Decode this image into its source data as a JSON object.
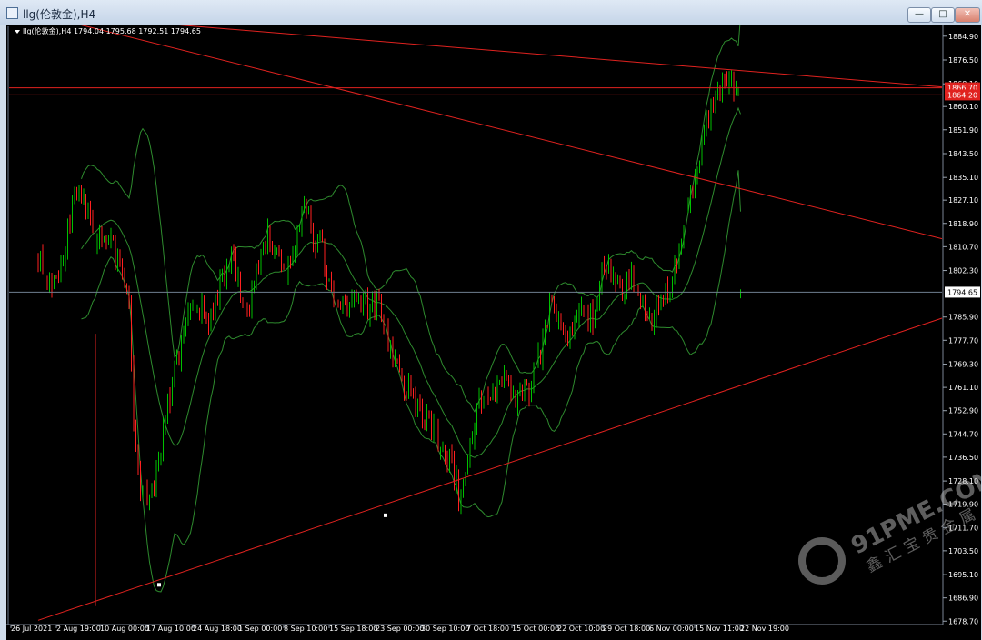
{
  "window": {
    "title": "llg(伦敦金),H4",
    "controls": {
      "minimize": "—",
      "maximize": "□",
      "close": "✕"
    }
  },
  "chart_data": {
    "type": "candlestick",
    "symbol_line": "llg(伦敦金),H4  1794.04 1795.68 1792.51 1794.65",
    "ohlc": {
      "open": 1794.04,
      "high": 1795.68,
      "low": 1792.51,
      "close": 1794.65
    },
    "ylim": [
      1677.5,
      1889
    ],
    "y_ticks": [
      1884.9,
      1876.5,
      1868.1,
      1860.1,
      1851.9,
      1843.5,
      1835.1,
      1827.1,
      1818.9,
      1810.7,
      1802.3,
      1785.9,
      1777.7,
      1769.3,
      1761.1,
      1752.9,
      1744.7,
      1736.5,
      1728.1,
      1719.9,
      1711.7,
      1703.5,
      1695.1,
      1686.9,
      1678.7
    ],
    "y_tick_labels": [
      "1884.90",
      "1876.50",
      "1868.10",
      "1860.10",
      "1851.90",
      "1843.50",
      "1835.10",
      "1827.10",
      "1818.90",
      "1810.70",
      "1802.30",
      "1785.90",
      "1777.70",
      "1769.30",
      "1761.10",
      "1752.90",
      "1744.70",
      "1736.50",
      "1728.10",
      "1719.90",
      "1711.70",
      "1703.50",
      "1695.10",
      "1686.90",
      "1678.70"
    ],
    "x_ticks": [
      "26 Jul 2021",
      "2 Aug 19:00",
      "10 Aug 00:00",
      "17 Aug 10:00",
      "24 Aug 18:00",
      "1 Sep 00:00",
      "8 Sep 10:00",
      "15 Sep 18:00",
      "23 Sep 00:00",
      "30 Sep 10:00",
      "7 Oct 18:00",
      "15 Oct 00:00",
      "22 Oct 10:00",
      "29 Oct 18:00",
      "6 Nov 00:00",
      "15 Nov 11:00",
      "22 Nov 19:00"
    ],
    "bars_count": 310,
    "path": [
      [
        0,
        1808
      ],
      [
        6,
        1797
      ],
      [
        10,
        1798
      ],
      [
        14,
        1816
      ],
      [
        18,
        1830
      ],
      [
        22,
        1822
      ],
      [
        26,
        1815
      ],
      [
        30,
        1815
      ],
      [
        34,
        1812
      ],
      [
        38,
        1802
      ],
      [
        41,
        1790
      ],
      [
        43,
        1750
      ],
      [
        46,
        1727
      ],
      [
        50,
        1720
      ],
      [
        54,
        1735
      ],
      [
        58,
        1755
      ],
      [
        62,
        1770
      ],
      [
        66,
        1782
      ],
      [
        70,
        1793
      ],
      [
        74,
        1788
      ],
      [
        78,
        1785
      ],
      [
        82,
        1800
      ],
      [
        86,
        1808
      ],
      [
        90,
        1796
      ],
      [
        94,
        1790
      ],
      [
        98,
        1805
      ],
      [
        102,
        1815
      ],
      [
        106,
        1808
      ],
      [
        110,
        1802
      ],
      [
        114,
        1812
      ],
      [
        118,
        1830
      ],
      [
        122,
        1814
      ],
      [
        126,
        1810
      ],
      [
        130,
        1795
      ],
      [
        134,
        1792
      ],
      [
        138,
        1790
      ],
      [
        142,
        1793
      ],
      [
        146,
        1788
      ],
      [
        150,
        1792
      ],
      [
        154,
        1780
      ],
      [
        158,
        1770
      ],
      [
        162,
        1760
      ],
      [
        166,
        1758
      ],
      [
        170,
        1752
      ],
      [
        174,
        1748
      ],
      [
        178,
        1740
      ],
      [
        182,
        1735
      ],
      [
        186,
        1723
      ],
      [
        190,
        1738
      ],
      [
        194,
        1752
      ],
      [
        198,
        1758
      ],
      [
        202,
        1760
      ],
      [
        206,
        1765
      ],
      [
        210,
        1758
      ],
      [
        214,
        1760
      ],
      [
        218,
        1762
      ],
      [
        222,
        1775
      ],
      [
        226,
        1790
      ],
      [
        230,
        1783
      ],
      [
        234,
        1776
      ],
      [
        238,
        1786
      ],
      [
        242,
        1788
      ],
      [
        246,
        1785
      ],
      [
        250,
        1806
      ],
      [
        254,
        1798
      ],
      [
        258,
        1795
      ],
      [
        262,
        1802
      ],
      [
        266,
        1792
      ],
      [
        270,
        1785
      ],
      [
        274,
        1792
      ],
      [
        278,
        1794
      ],
      [
        282,
        1805
      ],
      [
        286,
        1822
      ],
      [
        290,
        1834
      ],
      [
        294,
        1852
      ],
      [
        298,
        1862
      ],
      [
        302,
        1866
      ],
      [
        306,
        1869
      ],
      [
        310,
        1865
      ],
      [
        314,
        1862
      ],
      [
        318,
        1862
      ],
      [
        322,
        1848
      ],
      [
        326,
        1815
      ],
      [
        329,
        1792
      ],
      [
        331,
        1794.65
      ]
    ],
    "bollinger_bands": {
      "period": 20,
      "deviations": 2
    },
    "current_price": 1794.65,
    "current_price_label": "1794.65",
    "horizontal_lines": [
      1866.7,
      1864.2
    ],
    "horizontal_line_labels": [
      "1866.70",
      "1864.20"
    ],
    "trendlines": [
      {
        "from": [
          10,
          1893
        ],
        "to": [
          331,
          1867.0
        ]
      },
      {
        "from": [
          10,
          1893
        ],
        "to": [
          331,
          1813.5
        ]
      },
      {
        "from": [
          12,
          1679
        ],
        "to": [
          331,
          1785.5
        ]
      }
    ],
    "trendline_anchors": [
      [
        50,
        1691.5
      ],
      [
        144,
        1716
      ]
    ],
    "vertical_marker": {
      "x": 43,
      "from": 1684,
      "to": 1780
    },
    "colors": {
      "background": "#000000",
      "bull": "#00c000",
      "bear": "#ff2020",
      "bands": "#2e8b2e",
      "trendline": "#e0221f",
      "hline": "#e0221f",
      "price_line": "#6f7f90",
      "axis_text": "#ffffff",
      "hline_tag": "#e0221f"
    }
  },
  "watermark": {
    "logo_text": "91PME.COM",
    "sub_text": "鑫汇宝贵金属"
  }
}
